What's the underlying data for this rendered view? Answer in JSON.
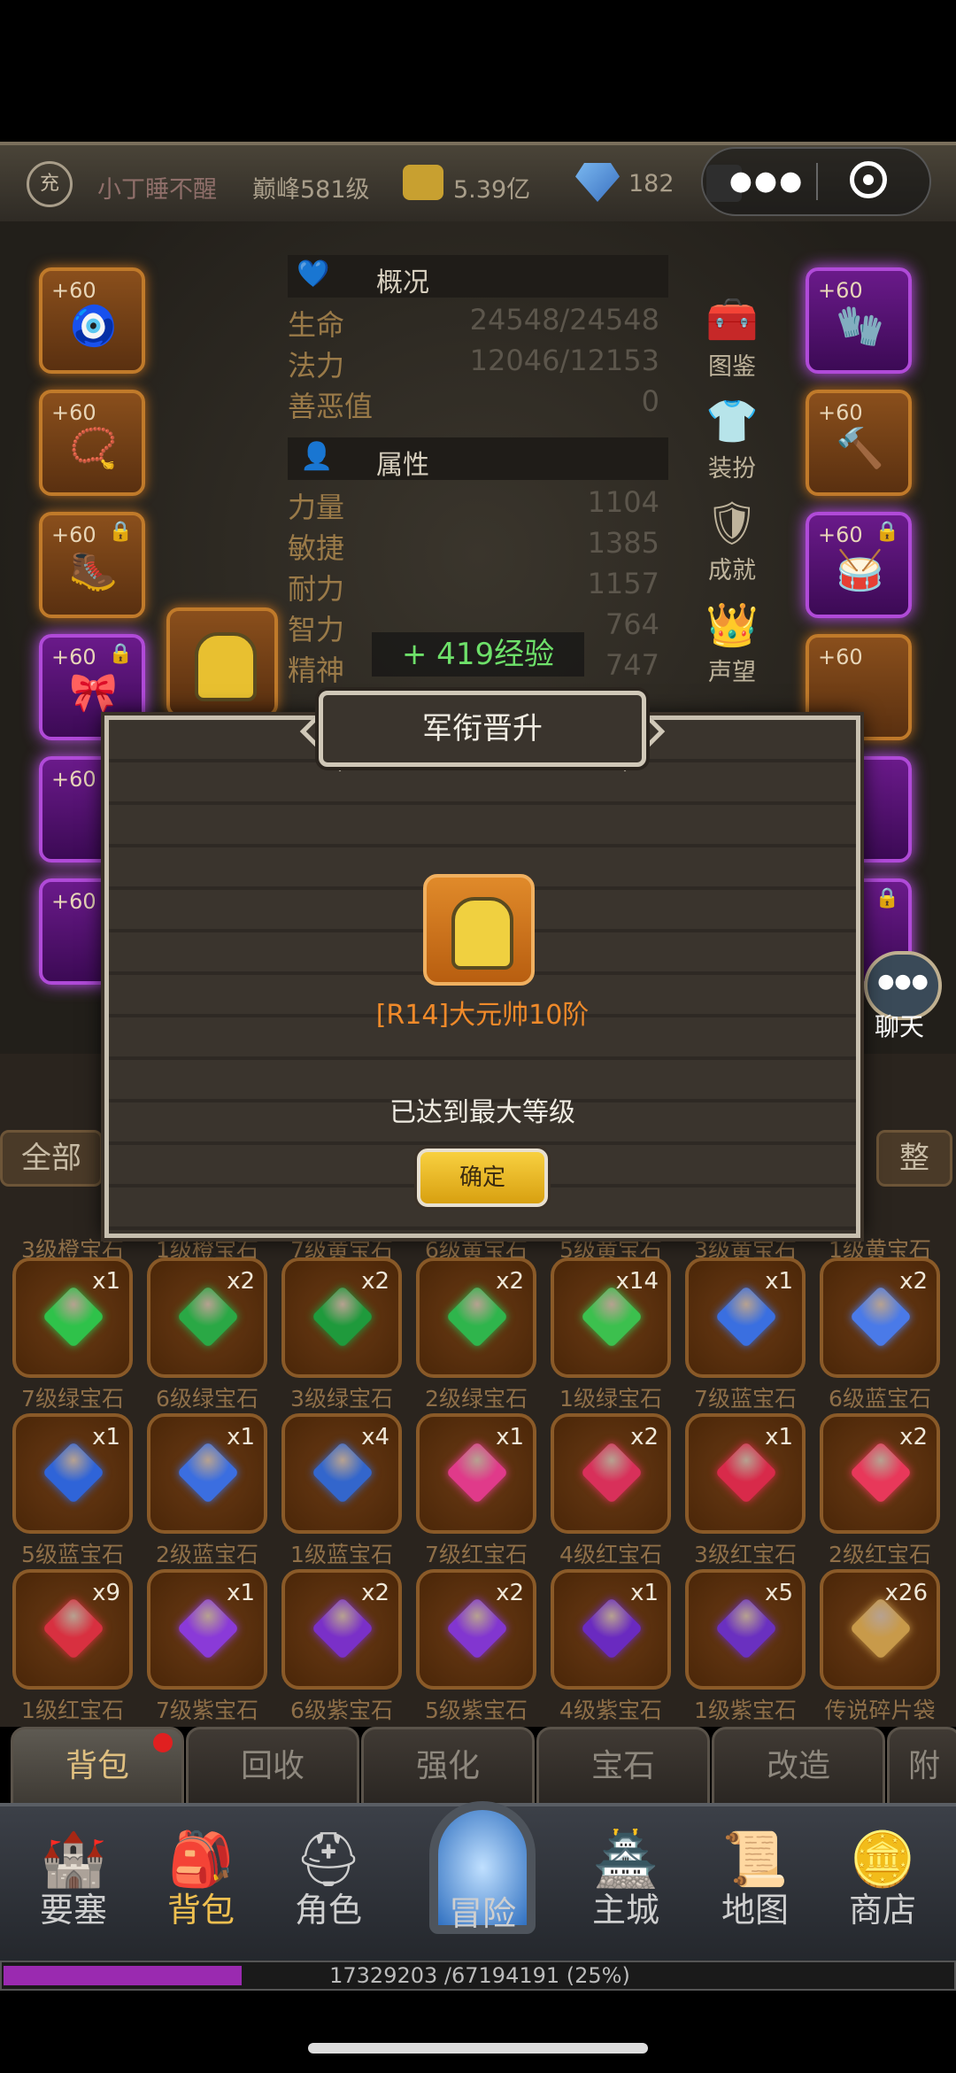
{
  "topbar": {
    "badge": "充",
    "player_name": "小丁睡不醒",
    "level": "巅峰581级",
    "gold": "5.39亿",
    "diamond": "182"
  },
  "overview": {
    "header": "概况",
    "rows": [
      {
        "label": "生命",
        "value": "24548/24548"
      },
      {
        "label": "法力",
        "value": "12046/12153"
      },
      {
        "label": "善恶值",
        "value": "0"
      }
    ]
  },
  "attributes": {
    "header": "属性",
    "rows": [
      {
        "label": "力量",
        "value": "1104"
      },
      {
        "label": "敏捷",
        "value": "1385"
      },
      {
        "label": "耐力",
        "value": "1157"
      },
      {
        "label": "智力",
        "value": "764"
      },
      {
        "label": "精神",
        "value": "747"
      }
    ]
  },
  "exp_gain": "+ 419经验",
  "side_menu": [
    "图鉴",
    "装扮",
    "成就",
    "声望"
  ],
  "equip_plus": "+60",
  "chat_label": "聊天",
  "modal": {
    "title": "军衔晋升",
    "rank_name": "[R14]大元帅10阶",
    "message": "已达到最大等级",
    "confirm": "确定"
  },
  "bag": {
    "all_label": "全部",
    "sort_label": "整",
    "top_row_labels": [
      "3级橙宝石",
      "1级橙宝石",
      "7级黄宝石",
      "6级黄宝石",
      "5级黄宝石",
      "3级黄宝石",
      "1级黄宝石"
    ],
    "rows": [
      [
        {
          "name": "7级绿宝石",
          "count": "x1",
          "color": "#2fc24a"
        },
        {
          "name": "6级绿宝石",
          "count": "x2",
          "color": "#2aa845"
        },
        {
          "name": "3级绿宝石",
          "count": "x2",
          "color": "#1f9a3c"
        },
        {
          "name": "2级绿宝石",
          "count": "x2",
          "color": "#2fb54c"
        },
        {
          "name": "1级绿宝石",
          "count": "x14",
          "color": "#3cc04e"
        },
        {
          "name": "7级蓝宝石",
          "count": "x1",
          "color": "#3a6fe0"
        },
        {
          "name": "6级蓝宝石",
          "count": "x2",
          "color": "#4a7ae8"
        }
      ],
      [
        {
          "name": "5级蓝宝石",
          "count": "x1",
          "color": "#2f64d8"
        },
        {
          "name": "2级蓝宝石",
          "count": "x1",
          "color": "#3b6ee0"
        },
        {
          "name": "1级蓝宝石",
          "count": "x4",
          "color": "#3366cc"
        },
        {
          "name": "7级红宝石",
          "count": "x1",
          "color": "#e03a8a"
        },
        {
          "name": "4级红宝石",
          "count": "x2",
          "color": "#d8305a"
        },
        {
          "name": "3级红宝石",
          "count": "x1",
          "color": "#d82a4a"
        },
        {
          "name": "2级红宝石",
          "count": "x2",
          "color": "#e8385a"
        }
      ],
      [
        {
          "name": "1级红宝石",
          "count": "x9",
          "color": "#d83040"
        },
        {
          "name": "7级紫宝石",
          "count": "x1",
          "color": "#8a3ad8"
        },
        {
          "name": "6级紫宝石",
          "count": "x2",
          "color": "#7a30c8"
        },
        {
          "name": "5级紫宝石",
          "count": "x2",
          "color": "#8236d0"
        },
        {
          "name": "4级紫宝石",
          "count": "x1",
          "color": "#6a2ac0"
        },
        {
          "name": "1级紫宝石",
          "count": "x5",
          "color": "#6a30c0"
        },
        {
          "name": "传说碎片袋",
          "count": "x26",
          "color": "#c89a4a"
        }
      ]
    ]
  },
  "tabs": [
    "背包",
    "回收",
    "强化",
    "宝石",
    "改造",
    "附"
  ],
  "nav": [
    "要塞",
    "背包",
    "角色",
    "冒险",
    "主城",
    "地图",
    "商店"
  ],
  "exp_bar": {
    "text": "17329203 /67194191 (25%)",
    "progress": 0.25
  }
}
